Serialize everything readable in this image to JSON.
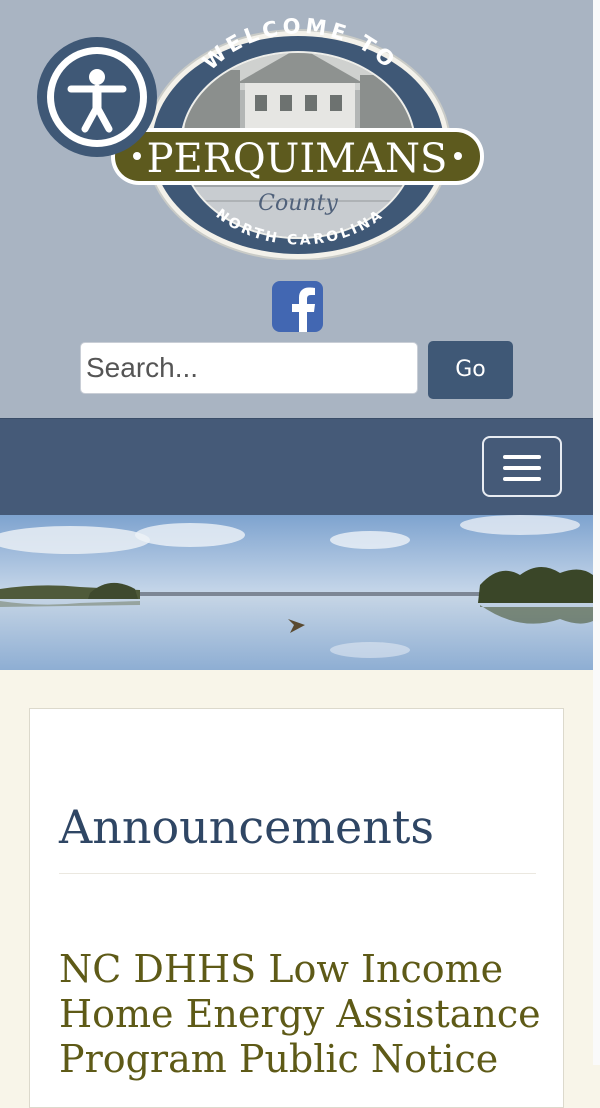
{
  "accessibility": {
    "icon": "accessibility-person-icon"
  },
  "logo": {
    "top_arc_text": "WELCOME TO",
    "name": "PERQUIMANS",
    "script_text": "County",
    "bottom_arc_text": "NORTH CAROLINA"
  },
  "social": {
    "facebook_icon": "facebook-icon"
  },
  "search": {
    "placeholder": "Search...",
    "value": "",
    "button_label": "Go"
  },
  "nav": {
    "toggle_icon": "hamburger-menu-icon"
  },
  "content": {
    "section_heading": "Announcements",
    "article_title_lines": [
      "NC DHHS Low Income",
      "Home Energy Assistance",
      "Program Public Notice"
    ]
  },
  "colors": {
    "header_bg": "#a9b4c2",
    "navbar_bg": "#455a78",
    "page_bg": "#f8f5e9",
    "heading": "#2f4664",
    "article_link": "#5e5a17",
    "logo_banner": "#5d5a1e",
    "facebook": "#4267b2"
  }
}
